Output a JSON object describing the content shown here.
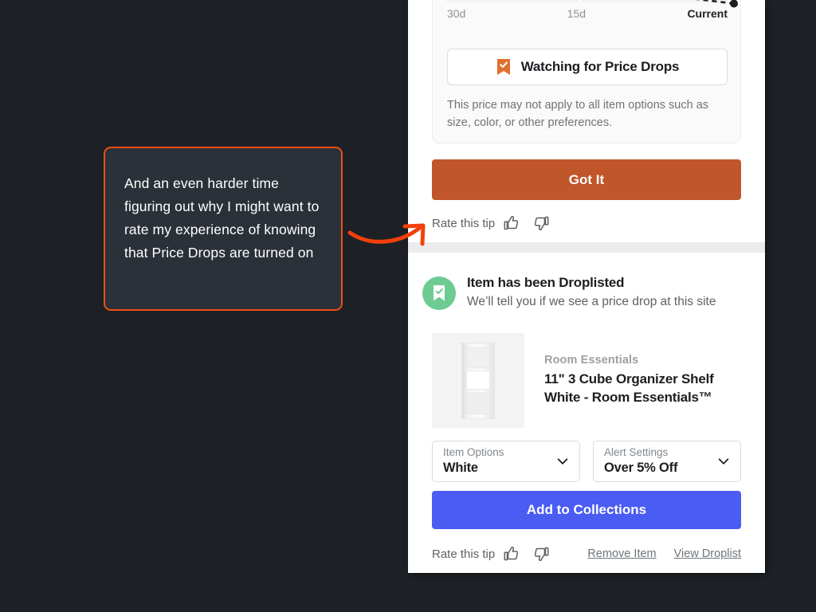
{
  "annotation": {
    "text": "And an even harder time figuring out why I might want to rate my experience of knowing that Price Drops are turned on",
    "border_color": "#f04e11",
    "background_color": "#2b3138",
    "arrow_color": "#f4400b"
  },
  "tip_card": {
    "axis_labels": [
      "30d",
      "15d",
      "Current"
    ],
    "watch_button_label": "Watching for Price Drops",
    "watch_icon": "bookmark-check-icon",
    "watch_icon_color": "#e1702f",
    "disclaimer": "This price may not apply to all item options such as size, color, or other preferences."
  },
  "got_it": {
    "label": "Got It",
    "color": "#c1562a"
  },
  "rate_top": {
    "label": "Rate this tip",
    "thumbs_up": "thumbs-up-icon",
    "thumbs_down": "thumbs-down-icon"
  },
  "droplist": {
    "icon": "bookmark-check-icon",
    "icon_background": "#6dcb92",
    "title": "Item has been Droplisted",
    "subtitle": "We’ll tell you if we see a price drop at this site"
  },
  "product": {
    "image_alt": "white-3-cube-organizer-shelf",
    "brand": "Room Essentials",
    "title": "11\" 3 Cube Organizer Shelf White - Room Essentials™"
  },
  "selects": [
    {
      "label": "Item Options",
      "value": "White",
      "icon": "chevron-down-icon"
    },
    {
      "label": "Alert Settings",
      "value": "Over 5% Off",
      "icon": "chevron-down-icon"
    }
  ],
  "add_button": {
    "label": "Add to Collections",
    "color": "#4a5cf2"
  },
  "rate_bottom": {
    "label": "Rate this tip",
    "thumbs_up": "thumbs-up-icon",
    "thumbs_down": "thumbs-down-icon",
    "links": [
      "Remove Item",
      "View Droplist"
    ]
  },
  "chart_data": {
    "type": "bar",
    "title": "",
    "categories": [
      "30d",
      "15d",
      "Current"
    ],
    "values": [
      null,
      null,
      null
    ],
    "xlabel": "",
    "ylabel": "",
    "notes": "Price history card clipped at top of viewport: two light gray price bars with a black dashed trend line ending in a filled dot at the Current mark.",
    "grid": false,
    "legend": "none"
  }
}
